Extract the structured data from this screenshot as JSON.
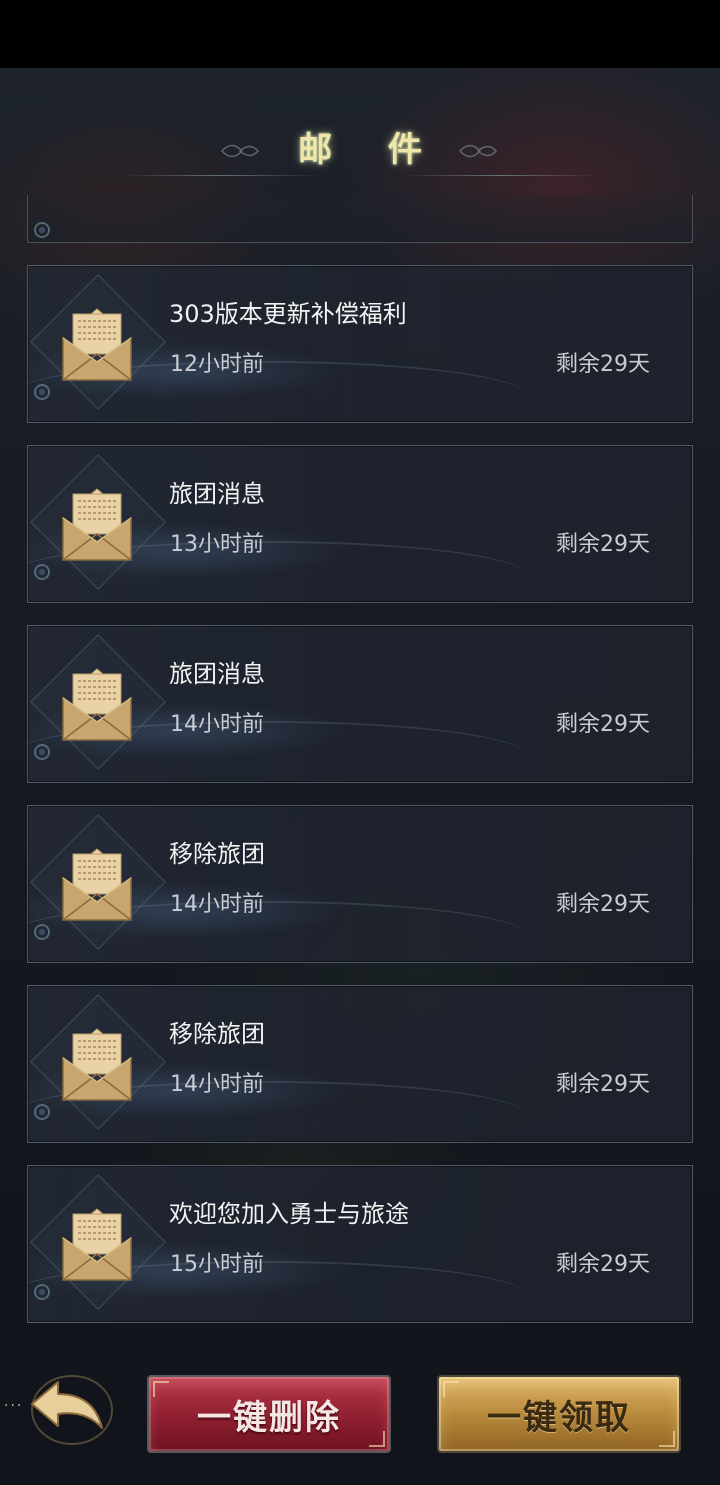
{
  "header": {
    "title": "邮 件"
  },
  "mails": [
    {
      "title": "303版本更新补偿福利",
      "time": "12小时前",
      "expire": "剩余29天"
    },
    {
      "title": "旅团消息",
      "time": "13小时前",
      "expire": "剩余29天"
    },
    {
      "title": "旅团消息",
      "time": "14小时前",
      "expire": "剩余29天"
    },
    {
      "title": "移除旅团",
      "time": "14小时前",
      "expire": "剩余29天"
    },
    {
      "title": "移除旅团",
      "time": "14小时前",
      "expire": "剩余29天"
    },
    {
      "title": "欢迎您加入勇士与旅途",
      "time": "15小时前",
      "expire": "剩余29天"
    }
  ],
  "footer": {
    "back_dots": "···",
    "delete_all_label": "一键删除",
    "claim_all_label": "一键领取"
  },
  "icons": {
    "envelope": "open-envelope-icon",
    "back": "back-arrow-icon"
  },
  "colors": {
    "title_glow": "#f0e6a8",
    "delete_button": "#8f1f30",
    "claim_button": "#b98a3c"
  }
}
